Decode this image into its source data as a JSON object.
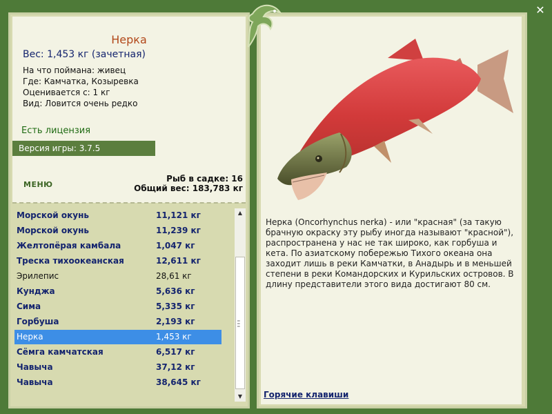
{
  "fish": {
    "title": "Нерка",
    "weight": "Вес: 1,453 кг (зачетная)",
    "bait": "На что поймана: живец",
    "place": "Где: Камчатка, Козыревка",
    "rated_from": "Оценивается с: 1 кг",
    "rarity": "Вид: Ловится очень редко",
    "description": "Нерка (Oncorhynchus nerka) - или \"красная\" (за такую брачную окраску эту рыбу иногда называют \"красной\"), распространена у нас не так широко, как горбуша и кета. По азиатскому побережью Тихого океана она заходит лишь в реки Камчатки, в Анадырь и в меньшей степени в реки Командорских и Курильских островов. В длину представители этого вида достигают 80 см."
  },
  "license": "Есть лицензия",
  "version": "Версия игры: 3.7.5",
  "menu_label": "МЕНЮ",
  "stats": {
    "fish_count": "Рыб в садке: 16",
    "total_weight": "Общий вес: 183,783 кг"
  },
  "catch_list": [
    {
      "name": "Морской окунь",
      "weight": "11,121 кг",
      "bold": true
    },
    {
      "name": "Морской окунь",
      "weight": "11,239 кг",
      "bold": true
    },
    {
      "name": "Желтопёрая камбала",
      "weight": "1,047 кг",
      "bold": true
    },
    {
      "name": "Треска тихоокеанская",
      "weight": "12,611 кг",
      "bold": true
    },
    {
      "name": "Эрилепис",
      "weight": "28,61 кг",
      "bold": false
    },
    {
      "name": "Кунджа",
      "weight": "5,636 кг",
      "bold": true
    },
    {
      "name": "Сима",
      "weight": "5,335 кг",
      "bold": true
    },
    {
      "name": "Горбуша",
      "weight": "2,193 кг",
      "bold": true
    },
    {
      "name": "Нерка",
      "weight": "1,453 кг",
      "bold": false,
      "selected": true
    },
    {
      "name": "Сёмга камчатская",
      "weight": "6,517 кг",
      "bold": true
    },
    {
      "name": "Чавыча",
      "weight": "37,12 кг",
      "bold": true
    },
    {
      "name": "Чавыча",
      "weight": "38,645 кг",
      "bold": true
    }
  ],
  "hotkeys_link": "Горячие клавиши",
  "icons": {
    "close": "close-icon",
    "emblem": "fish-emblem-icon"
  },
  "colors": {
    "background": "#4e7a38",
    "selected_row": "#3d8ee6",
    "title": "#b2481a"
  }
}
